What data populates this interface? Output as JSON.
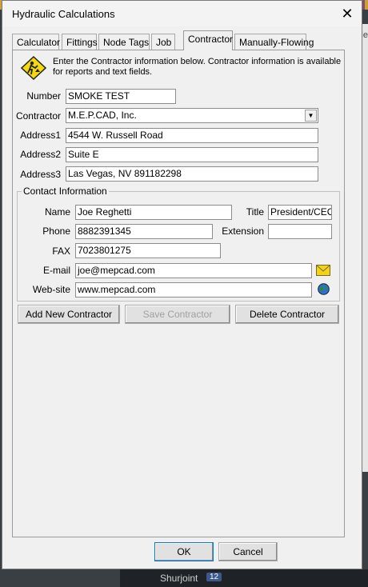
{
  "window": {
    "title": "Hydraulic Calculations",
    "close_glyph": "✕"
  },
  "tabs": [
    {
      "label": "Calculator",
      "active": false
    },
    {
      "label": "Fittings",
      "active": false
    },
    {
      "label": "Node Tags",
      "active": false
    },
    {
      "label": "Job",
      "active": false
    },
    {
      "label": "Contractor",
      "active": true
    },
    {
      "label": "Manually-Flowing",
      "active": false
    }
  ],
  "info": {
    "text": "Enter the Contractor information below. Contractor information is available for reports and text fields."
  },
  "form": {
    "number": {
      "label": "Number",
      "value": "SMOKE TEST"
    },
    "contractor": {
      "label": "Contractor",
      "value": "M.E.P.CAD, Inc."
    },
    "address1": {
      "label": "Address1",
      "value": "4544 W. Russell Road"
    },
    "address2": {
      "label": "Address2",
      "value": "Suite E"
    },
    "address3": {
      "label": "Address3",
      "value": "Las Vegas, NV 891182298"
    }
  },
  "contact": {
    "legend": "Contact Information",
    "name": {
      "label": "Name",
      "value": "Joe Reghetti"
    },
    "title": {
      "label": "Title",
      "value": "President/CEO"
    },
    "phone": {
      "label": "Phone",
      "value": "8882391345"
    },
    "extension": {
      "label": "Extension",
      "value": ""
    },
    "fax": {
      "label": "FAX",
      "value": "7023801275"
    },
    "email": {
      "label": "E-mail",
      "value": "joe@mepcad.com"
    },
    "website": {
      "label": "Web-site",
      "value": "www.mepcad.com"
    }
  },
  "actions": {
    "add": "Add New Contractor",
    "save": "Save Contractor",
    "delete": "Delete Contractor"
  },
  "footer": {
    "ok": "OK",
    "cancel": "Cancel"
  },
  "background": {
    "taskbar_label": "Shurjoint",
    "taskbar_badge": "12",
    "edge_text": "Ele"
  },
  "colors": {
    "accent": "#0078d7",
    "email_icon": "#f2d21a",
    "globe_icon": "#2a7a3a"
  }
}
